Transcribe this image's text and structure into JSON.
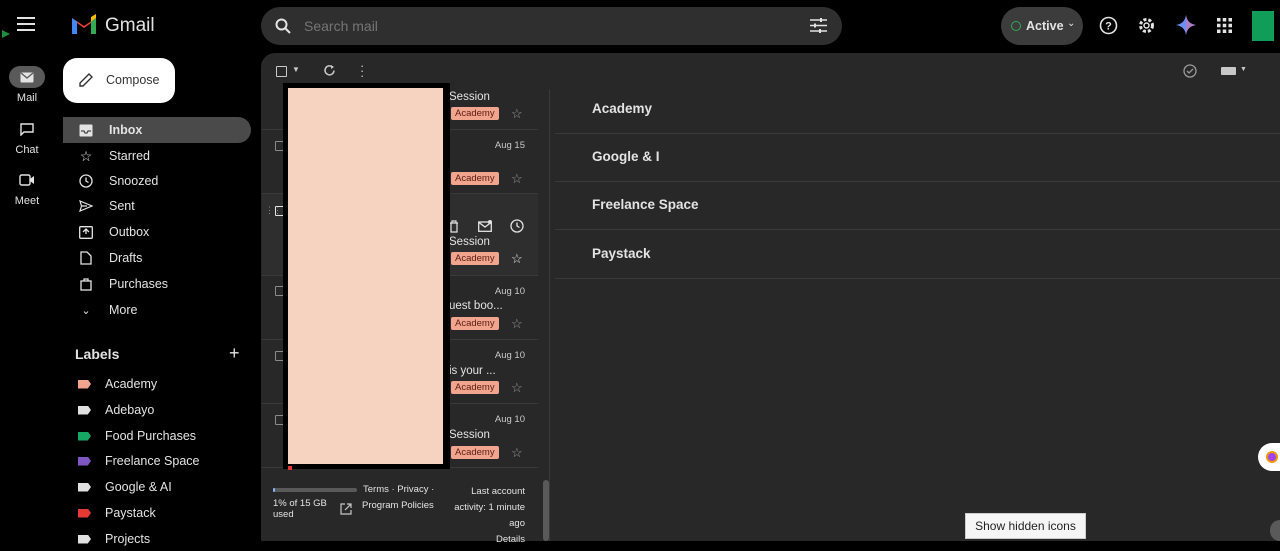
{
  "app": {
    "name": "Gmail"
  },
  "search": {
    "placeholder": "Search mail"
  },
  "status": {
    "label": "Active",
    "color": "#34a853"
  },
  "rail": [
    {
      "label": "Mail",
      "icon": "mail-icon"
    },
    {
      "label": "Chat",
      "icon": "chat-icon"
    },
    {
      "label": "Meet",
      "icon": "video-icon"
    }
  ],
  "compose": {
    "label": "Compose"
  },
  "nav": [
    {
      "label": "Inbox",
      "icon": "inbox-icon",
      "active": true
    },
    {
      "label": "Starred",
      "icon": "star-icon"
    },
    {
      "label": "Snoozed",
      "icon": "clock-icon"
    },
    {
      "label": "Sent",
      "icon": "send-icon"
    },
    {
      "label": "Outbox",
      "icon": "outbox-icon"
    },
    {
      "label": "Drafts",
      "icon": "draft-icon"
    },
    {
      "label": "Purchases",
      "icon": "bag-icon"
    },
    {
      "label": "More",
      "icon": "chevron-down-icon"
    }
  ],
  "labels": {
    "title": "Labels",
    "items": [
      {
        "label": "Academy",
        "color": "#f2a58e"
      },
      {
        "label": "Adebayo",
        "color": "#e0e0e0"
      },
      {
        "label": "Food Purchases",
        "color": "#16a765"
      },
      {
        "label": "Freelance Space",
        "color": "#7e57c2"
      },
      {
        "label": "Google & AI",
        "color": "#e0e0e0"
      },
      {
        "label": "Paystack",
        "color": "#e53935"
      },
      {
        "label": "Projects",
        "color": "#e0e0e0"
      }
    ]
  },
  "list": {
    "rows": [
      {
        "snippet": "Session",
        "badge": "Academy",
        "date": ""
      },
      {
        "snippet": "",
        "badge": "Academy",
        "date": "Aug 15"
      },
      {
        "snippet": "Session",
        "badge": "Academy",
        "date": ""
      },
      {
        "snippet": "uest boo...",
        "badge": "Academy",
        "date": "Aug 10"
      },
      {
        "snippet": "is your ...",
        "badge": "Academy",
        "date": "Aug 10"
      },
      {
        "snippet": "Session",
        "badge": "Academy",
        "date": "Aug 10"
      }
    ],
    "redaction_color": "#f6d3c0"
  },
  "footer": {
    "storage": "1% of 15 GB used",
    "storage_fraction": 0.01,
    "terms": "Terms · Privacy ·",
    "policies": "Program Policies",
    "activity_1": "Last account",
    "activity_2": "activity: 1 minute",
    "activity_3": "ago",
    "details": "Details"
  },
  "right": {
    "rows": [
      "Academy",
      "Google & I",
      "Freelance Space",
      "Paystack"
    ]
  },
  "tooltip": {
    "text": "Show hidden icons"
  }
}
